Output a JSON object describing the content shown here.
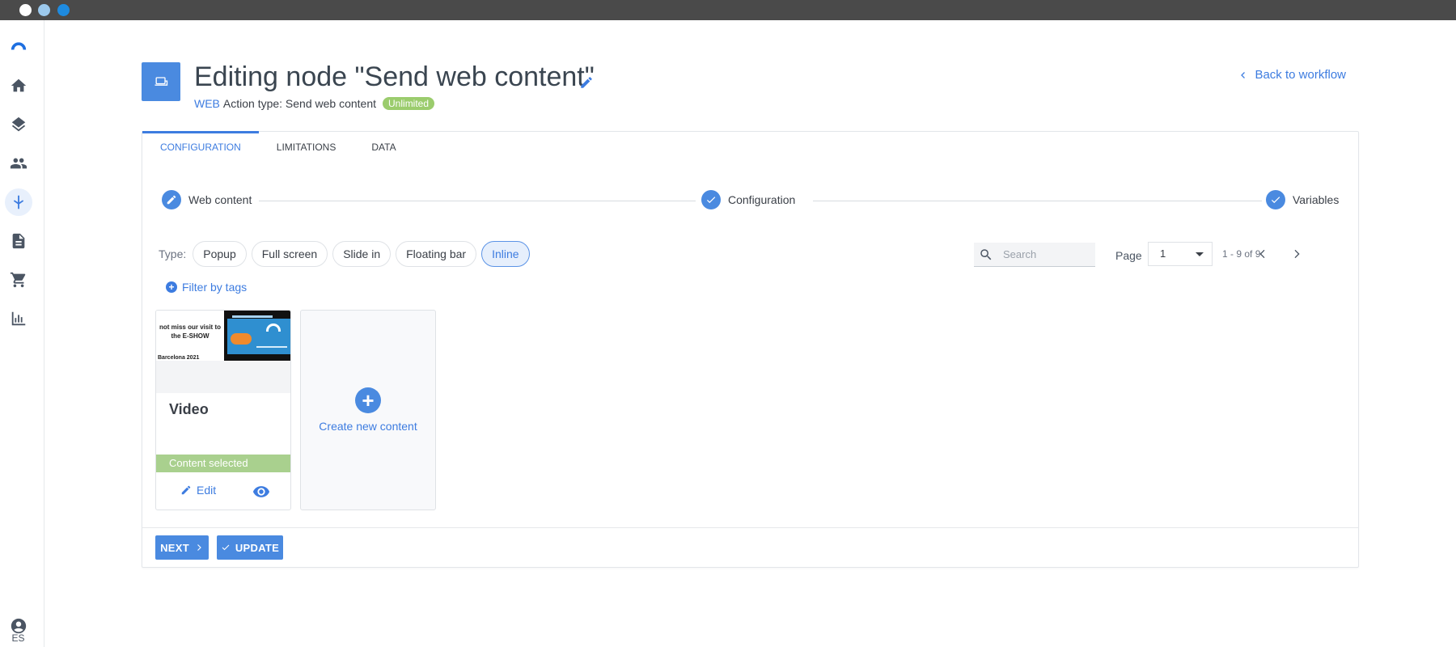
{
  "window": {
    "controls": [
      "close",
      "minimize",
      "maximize"
    ],
    "control_colors": [
      "#ffffff",
      "#9cc9ec",
      "#1e8be0"
    ]
  },
  "sidebar": {
    "logo_icon": "brand-logo-icon",
    "items": [
      {
        "icon": "home-icon",
        "active": false
      },
      {
        "icon": "layers-icon",
        "active": false
      },
      {
        "icon": "people-icon",
        "active": false
      },
      {
        "icon": "workflow-icon",
        "active": true
      },
      {
        "icon": "document-icon",
        "active": false
      },
      {
        "icon": "cart-icon",
        "active": false
      },
      {
        "icon": "bar-chart-icon",
        "active": false
      }
    ],
    "profile_icon": "account-circle-icon",
    "language": "ES"
  },
  "header": {
    "title": "Editing node \"Send web content\"",
    "channel": "WEB",
    "action_type": "Action type: Send web content",
    "badge": "Unlimited",
    "back_link": "Back to workflow"
  },
  "tabs": [
    {
      "label": "CONFIGURATION",
      "active": true
    },
    {
      "label": "LIMITATIONS",
      "active": false
    },
    {
      "label": "DATA",
      "active": false
    }
  ],
  "stepper": [
    {
      "label": "Web content",
      "icon": "pencil-icon",
      "state": "current"
    },
    {
      "label": "Configuration",
      "icon": "check-icon",
      "state": "done"
    },
    {
      "label": "Variables",
      "icon": "check-icon",
      "state": "done"
    }
  ],
  "type_filter": {
    "label": "Type:",
    "options": [
      "Popup",
      "Full screen",
      "Slide in",
      "Floating bar",
      "Inline"
    ],
    "selected": "Inline"
  },
  "search": {
    "placeholder": "Search",
    "value": ""
  },
  "pagination": {
    "page_label": "Page",
    "current_page": "1",
    "range": "1 - 9 of 9"
  },
  "filter_by_tags": "Filter by tags",
  "contents": [
    {
      "name": "Video",
      "thumb_text_line1": "not miss our visit to",
      "thumb_text_line2": "the E-SHOW",
      "thumb_text_line3": "Barcelona 2021",
      "status": "Content selected",
      "edit_label": "Edit"
    }
  ],
  "create_card": {
    "label": "Create new content"
  },
  "footer": {
    "next_label": "NEXT",
    "update_label": "UPDATE"
  },
  "colors": {
    "accent": "#3d7ce0",
    "selected_green": "#a9d08e",
    "badge_green": "#9bcc6d"
  }
}
